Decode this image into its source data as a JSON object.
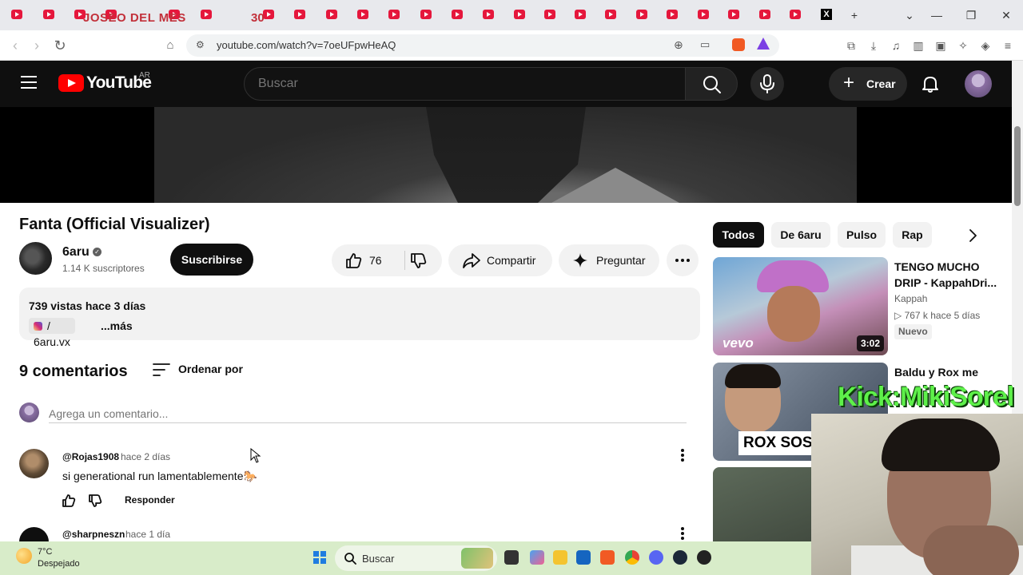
{
  "browser": {
    "overlay_title": "JOSEO DEL MES",
    "overlay_number": "30",
    "url": "youtube.com/watch?v=7oeUFpwHeAQ"
  },
  "header": {
    "logo_text": "YouTube",
    "region": "AR",
    "search_placeholder": "Buscar",
    "create_label": "Crear"
  },
  "video": {
    "title": "Fanta (Official Visualizer)",
    "channel_name": "6aru",
    "subscribers": "1.14 K suscriptores",
    "subscribe_label": "Suscribirse",
    "likes": "76",
    "share_label": "Compartir",
    "ask_label": "Preguntar",
    "stats": "739 vistas  hace 3 días",
    "desc_prefix": "/ 6aru.vx",
    "desc_more": "...más"
  },
  "comments": {
    "count_label": "9 comentarios",
    "sort_label": "Ordenar por",
    "input_placeholder": "Agrega un comentario...",
    "items": [
      {
        "author": "@Rojas1908",
        "time": "hace 2 días",
        "text": "si generational run lamentablemente🐎",
        "reply_label": "Responder"
      },
      {
        "author": "@sharpneszn",
        "time": "hace 1 día"
      }
    ]
  },
  "sidebar": {
    "chips": [
      "Todos",
      "De 6aru",
      "Pulso",
      "Rap"
    ],
    "recommendations": [
      {
        "title_line1": "TENGO MUCHO",
        "title_line2": "DRIP - KappahDri...",
        "channel": "Kappah",
        "meta": "767 k  hace 5 días",
        "badge": "Nuevo",
        "duration": "3:02",
        "thumb_label": "vevo"
      },
      {
        "title": "Baldu y Rox me",
        "thumb_label": "ROX SOS UI"
      }
    ]
  },
  "overlay": {
    "kick_text": "Kick:MikiSorel"
  },
  "taskbar": {
    "temperature": "7°C",
    "condition": "Despejado",
    "search_label": "Buscar"
  },
  "colors": {
    "youtube_red": "#ff0000",
    "header_bg": "#0f0f0f",
    "kick_green": "#5ef04a",
    "taskbar_bg": "#d8ecc9"
  }
}
